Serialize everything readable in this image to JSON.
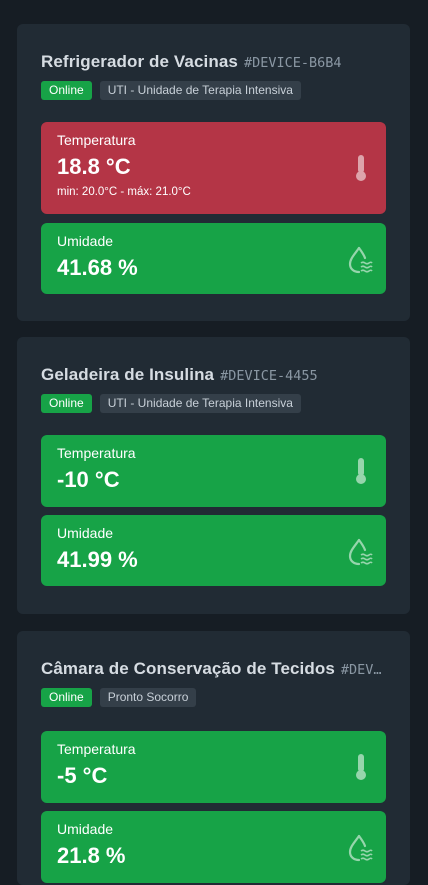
{
  "devices": [
    {
      "name": "Refrigerador de Vacinas",
      "id": "#DEVICE-B6B4",
      "status": "Online",
      "location": "UTI - Unidade de Terapia Intensiva",
      "temperature": {
        "label": "Temperatura",
        "value": "18.8 °C",
        "range": "min: 20.0°C - máx: 21.0°C",
        "state": "alert"
      },
      "humidity": {
        "label": "Umidade",
        "value": "41.68 %",
        "state": "ok"
      }
    },
    {
      "name": "Geladeira de Insulina",
      "id": "#DEVICE-4455",
      "status": "Online",
      "location": "UTI - Unidade de Terapia Intensiva",
      "temperature": {
        "label": "Temperatura",
        "value": "-10 °C",
        "state": "ok"
      },
      "humidity": {
        "label": "Umidade",
        "value": "41.99 %",
        "state": "ok"
      }
    },
    {
      "name": "Câmara de Conservação de Tecidos",
      "id": "#DEVICE-...",
      "status": "Online",
      "location": "Pronto Socorro",
      "temperature": {
        "label": "Temperatura",
        "value": "-5 °C",
        "state": "ok"
      },
      "humidity": {
        "label": "Umidade",
        "value": "21.8 %",
        "state": "ok"
      }
    }
  ],
  "icons": {
    "temperature": "thermometer-icon",
    "humidity": "humidity-icon"
  },
  "colors": {
    "ok": "#17a347",
    "alert": "#b43546",
    "card": "#212b34",
    "background": "#161d24"
  }
}
